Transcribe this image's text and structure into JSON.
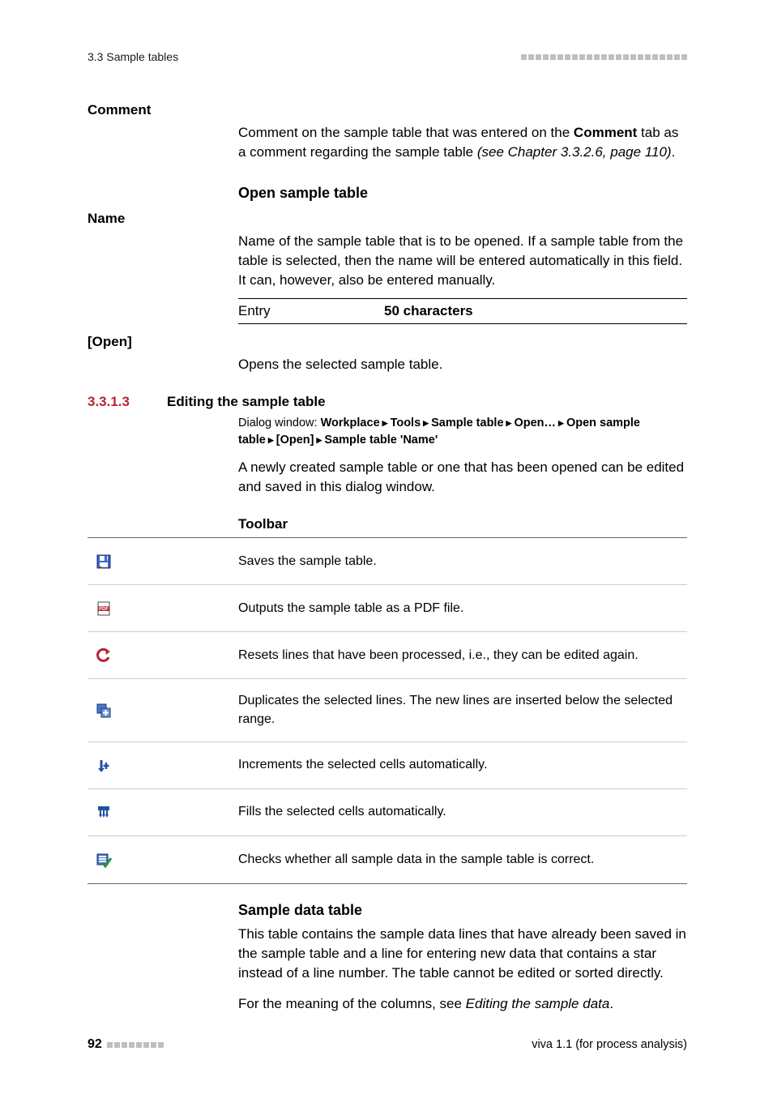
{
  "header": {
    "section_ref": "3.3 Sample tables"
  },
  "comment": {
    "term": "Comment",
    "text_1": "Comment on the sample table that was entered on the ",
    "bold": "Comment",
    "text_2": " tab as a comment regarding the sample table ",
    "italic": "(see Chapter 3.3.2.6, page 110)",
    "text_3": "."
  },
  "open_sample": {
    "heading": "Open sample table",
    "name_term": "Name",
    "name_text": "Name of the sample table that is to be opened. If a sample table from the table is selected, then the name will be entered automatically in this field. It can, however, also be entered manually.",
    "entry_label": "Entry",
    "entry_value": "50 characters",
    "open_term": "[Open]",
    "open_text": "Opens the selected sample table."
  },
  "section": {
    "num": "3.3.1.3",
    "title": "Editing the sample table",
    "dialog_label": "Dialog window: ",
    "breadcrumb": [
      "Workplace",
      "Tools",
      "Sample table",
      "Open…",
      "Open sample table",
      "[Open]",
      "Sample table 'Name'"
    ],
    "p1": "A newly created sample table or one that has been opened can be edited and saved in this dialog window.",
    "toolbar_h": "Toolbar"
  },
  "toolbar_rows": [
    {
      "id": "save",
      "desc": "Saves the sample table."
    },
    {
      "id": "pdf",
      "desc": "Outputs the sample table as a PDF file."
    },
    {
      "id": "reset",
      "desc": "Resets lines that have been processed, i.e., they can be edited again."
    },
    {
      "id": "duplicate",
      "desc": "Duplicates the selected lines. The new lines are inserted below the selected range."
    },
    {
      "id": "increment",
      "desc": "Increments the selected cells automatically."
    },
    {
      "id": "fill",
      "desc": "Fills the selected cells automatically."
    },
    {
      "id": "check",
      "desc": "Checks whether all sample data in the sample table is correct."
    }
  ],
  "sample_data": {
    "heading": "Sample data table",
    "p1": "This table contains the sample data lines that have already been saved in the sample table and a line for entering new data that contains a star instead of a line number. The table cannot be edited or sorted directly.",
    "p2_a": "For the meaning of the columns, see ",
    "p2_italic": "Editing the sample data",
    "p2_b": "."
  },
  "footer": {
    "page": "92",
    "right": "viva 1.1 (for process analysis)"
  }
}
